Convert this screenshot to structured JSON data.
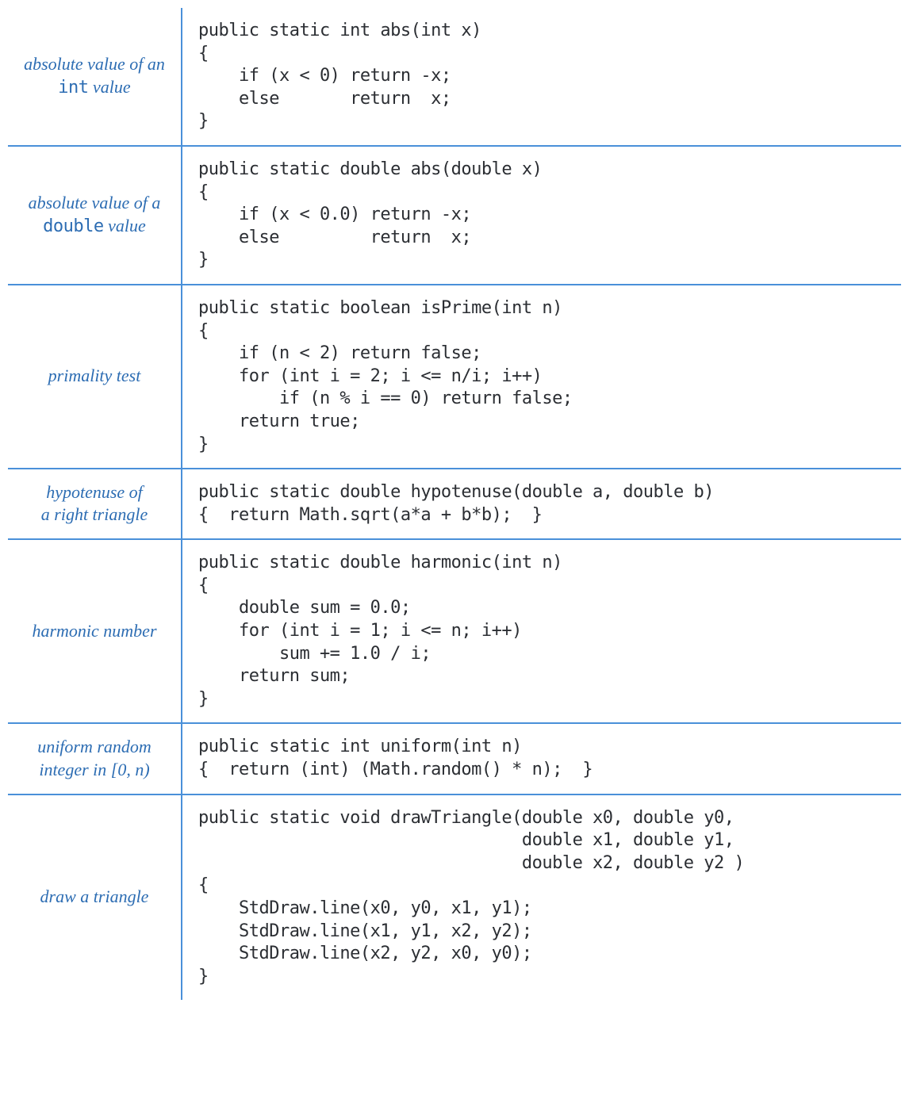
{
  "rows": [
    {
      "label_pre": "absolute value of an\n",
      "label_mono": "int",
      "label_post": " value",
      "code": "public static int abs(int x)\n{\n    if (x < 0) return -x;\n    else       return  x;\n}"
    },
    {
      "label_pre": "absolute value of a\n",
      "label_mono": "double",
      "label_post": " value",
      "code": "public static double abs(double x)\n{\n    if (x < 0.0) return -x;\n    else         return  x;\n}"
    },
    {
      "label_pre": "primality test",
      "label_mono": "",
      "label_post": "",
      "code": "public static boolean isPrime(int n)\n{\n    if (n < 2) return false;\n    for (int i = 2; i <= n/i; i++)\n        if (n % i == 0) return false;\n    return true;\n}"
    },
    {
      "label_pre": "hypotenuse of\na right triangle",
      "label_mono": "",
      "label_post": "",
      "code": "public static double hypotenuse(double a, double b)\n{  return Math.sqrt(a*a + b*b);  }"
    },
    {
      "label_pre": "harmonic number",
      "label_mono": "",
      "label_post": "",
      "code": "public static double harmonic(int n)\n{\n    double sum = 0.0;\n    for (int i = 1; i <= n; i++)\n        sum += 1.0 / i;\n    return sum;\n}"
    },
    {
      "label_pre": "uniform random\ninteger in ",
      "label_mono": "",
      "label_post": "[0, n)",
      "code": "public static int uniform(int n)\n{  return (int) (Math.random() * n);  }"
    },
    {
      "label_pre": "draw a triangle",
      "label_mono": "",
      "label_post": "",
      "code": "public static void drawTriangle(double x0, double y0,\n                                double x1, double y1,\n                                double x2, double y2 )\n{\n    StdDraw.line(x0, y0, x1, y1);\n    StdDraw.line(x1, y1, x2, y2);\n    StdDraw.line(x2, y2, x0, y0);\n}"
    }
  ]
}
